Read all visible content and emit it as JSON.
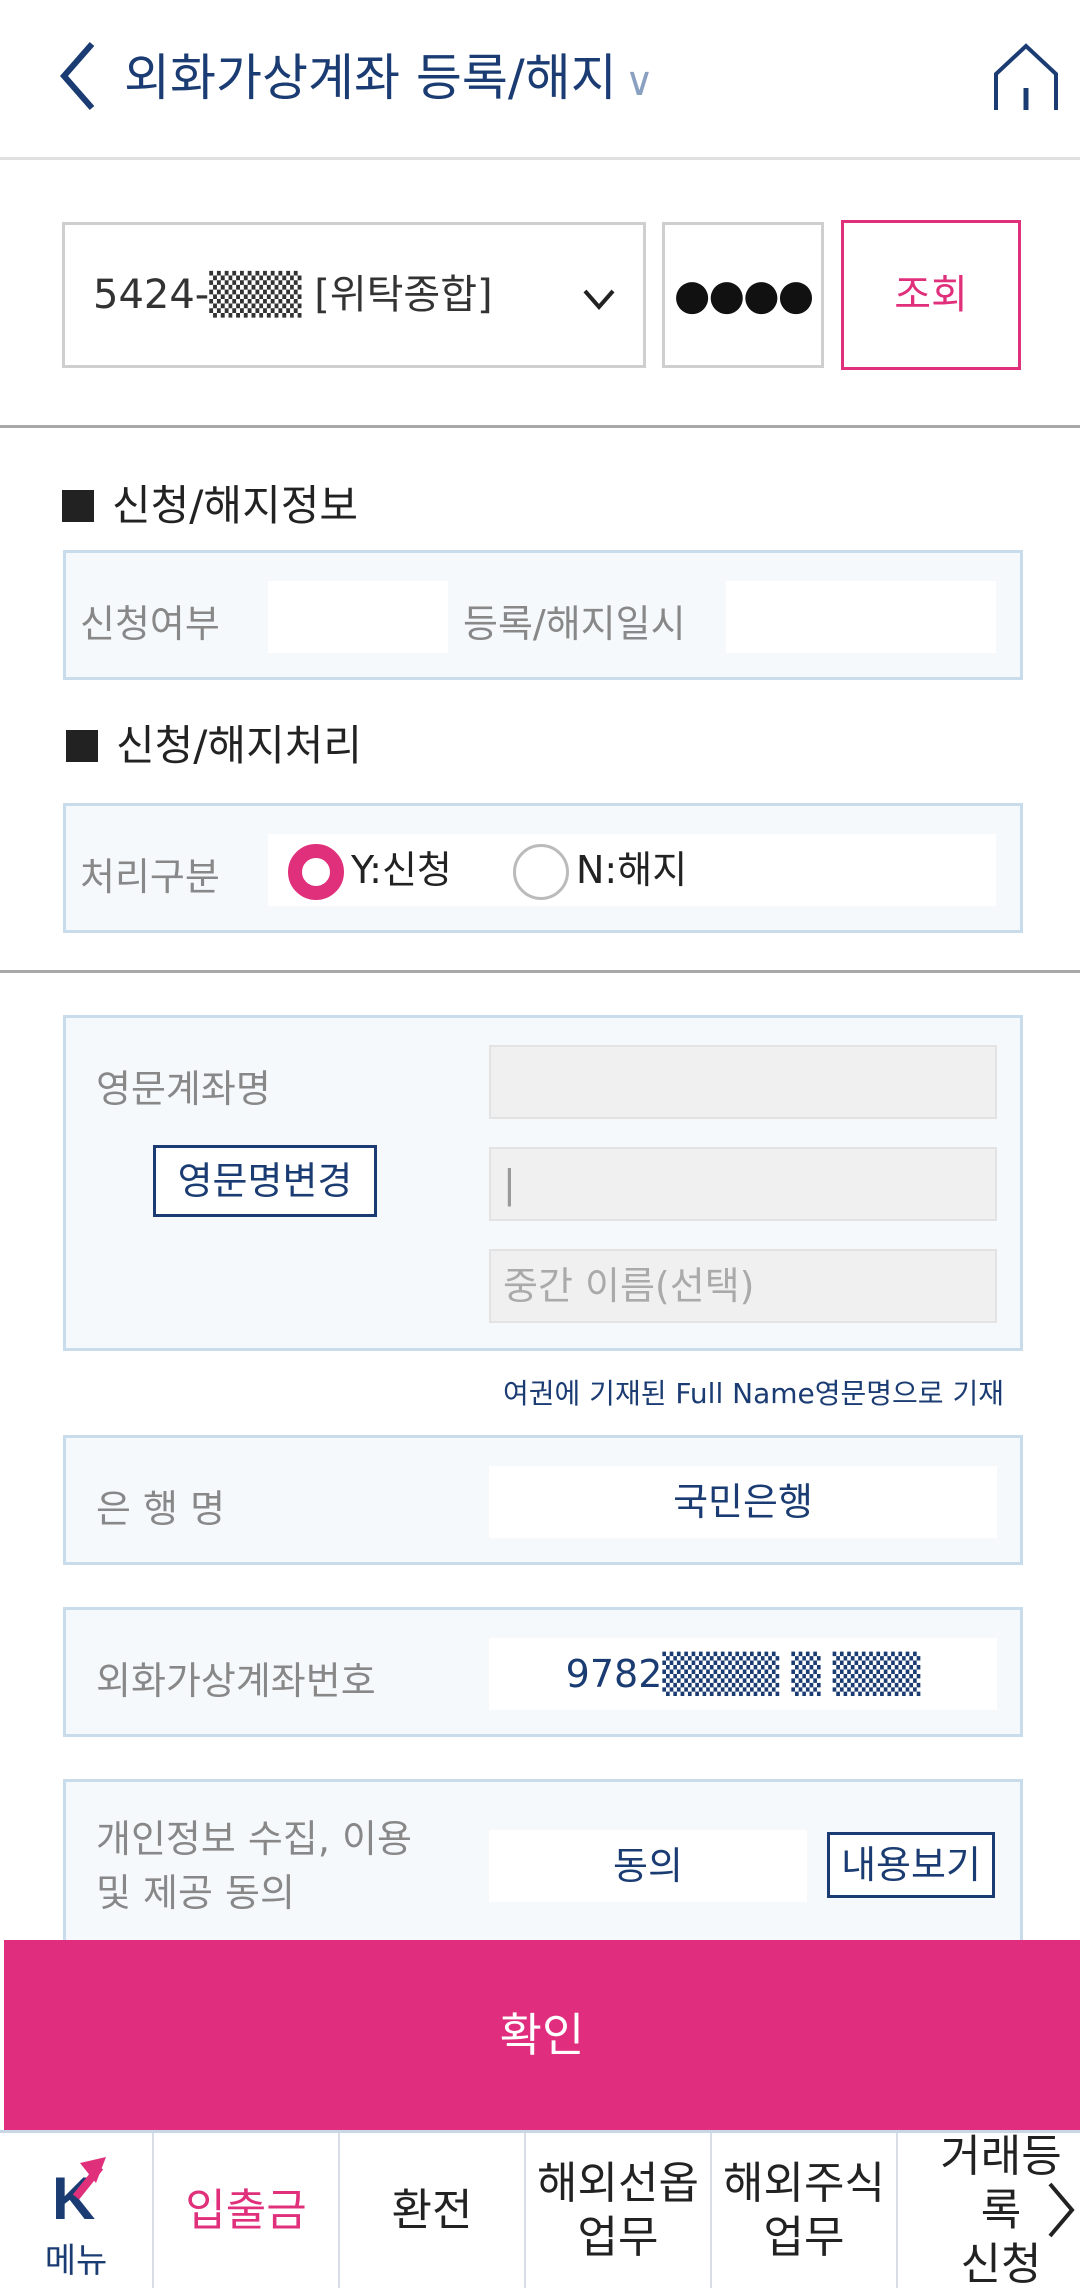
{
  "header": {
    "title": "외화가상계좌 등록/해지",
    "title_chevron": "∨",
    "back_icon": "chevron-left-icon",
    "home_icon": "home-icon"
  },
  "account": {
    "selected": "5424-▒▒▒ [위탁종합]",
    "password_mask": "●●●●",
    "search_label": "조회"
  },
  "info_section": {
    "title": "신청/해지정보",
    "apply_label": "신청여부",
    "apply_value": "",
    "date_label": "등록/해지일시",
    "date_value": ""
  },
  "process_section": {
    "title": "신청/해지처리",
    "label": "처리구분",
    "options": [
      {
        "label": "Y:신청",
        "selected": true
      },
      {
        "label": "N:해지",
        "selected": false
      }
    ]
  },
  "english_name": {
    "label": "영문계좌명",
    "change_button": "영문명변경",
    "first_value": "",
    "last_value": "|",
    "middle_placeholder": "중간 이름(선택)",
    "note": "여권에 기재된 Full Name영문명으로 기재"
  },
  "bank": {
    "label": "은 행 명",
    "value": "국민은행"
  },
  "virtual_account": {
    "label": "외화가상계좌번호",
    "value": "9782▒▒▒▒ ▒ ▒▒▒"
  },
  "privacy": {
    "label_line1": "개인정보 수집, 이용",
    "label_line2": "및 제공 동의",
    "value": "동의",
    "view_button": "내용보기"
  },
  "confirm_label": "확인",
  "bottom_nav": {
    "menu_logo": "K",
    "menu_label": "메뉴",
    "items": [
      {
        "line1": "입출금",
        "line2": "",
        "active": true
      },
      {
        "line1": "환전",
        "line2": "",
        "active": false
      },
      {
        "line1": "해외선옵",
        "line2": "업무",
        "active": false
      },
      {
        "line1": "해외주식",
        "line2": "업무",
        "active": false
      },
      {
        "line1": "거래등록",
        "line2": "신청",
        "active": false
      }
    ],
    "more_icon": "chevron-right-icon"
  },
  "colors": {
    "accent": "#e0307b",
    "navy": "#1b3c73",
    "box_border": "#c9dcec",
    "box_bg": "#f5f9fc"
  }
}
